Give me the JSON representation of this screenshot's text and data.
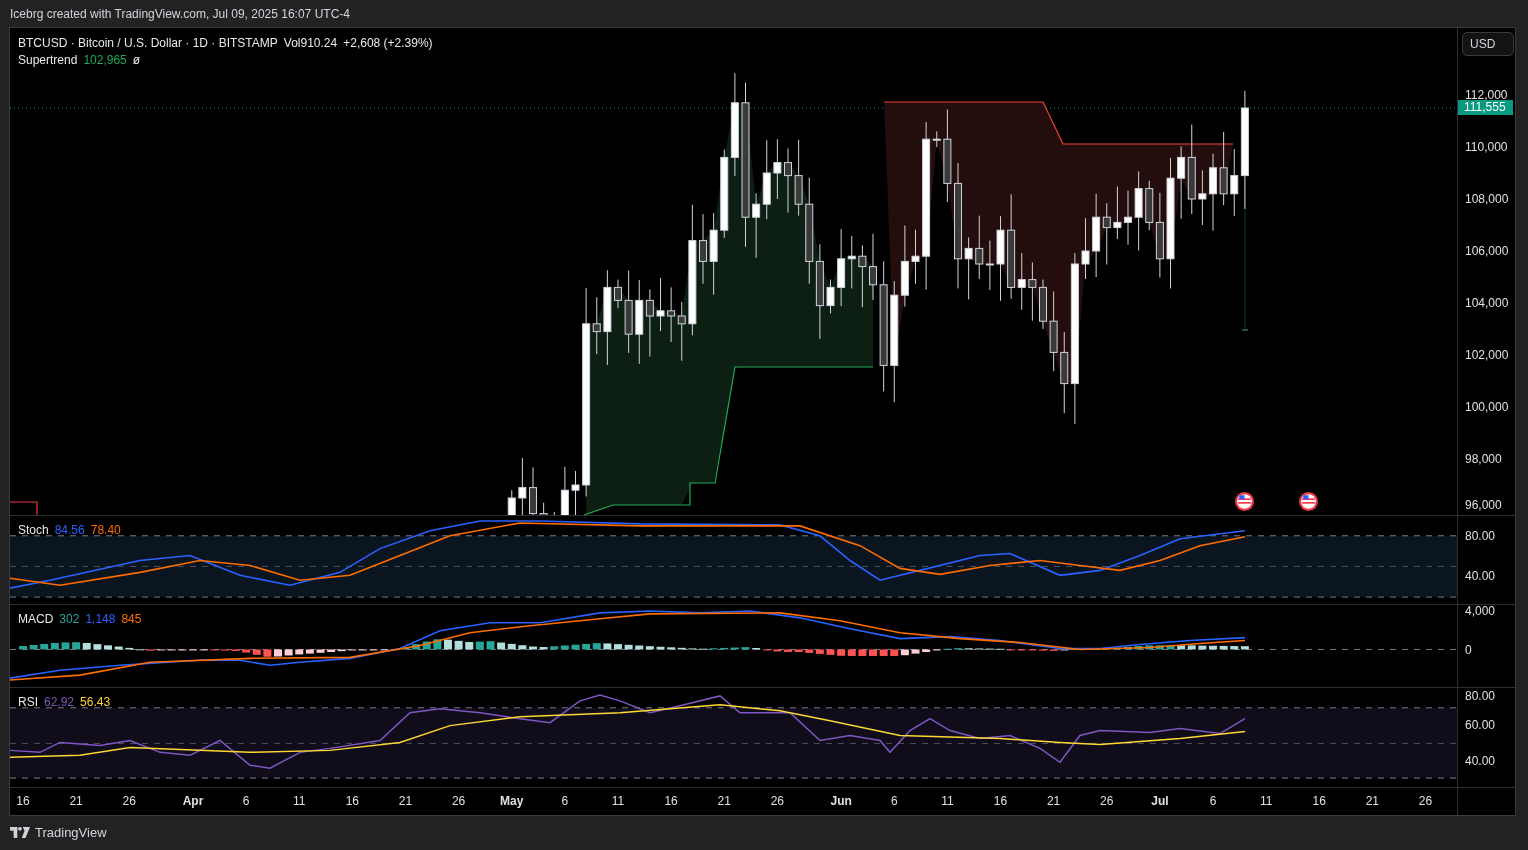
{
  "caption": "Icebrg created with TradingView.com, Jul 09, 2025 16:07 UTC-4",
  "price_panel": {
    "symbol": "BTCUSD · Bitcoin / U.S. Dollar · 1D · BITSTAMP",
    "volume": "Vol910.24",
    "change": "+2,608 (+2.39%)",
    "indicator": {
      "name": "Supertrend",
      "value": "102,965",
      "symbol": "ø"
    },
    "currency_button": "USD",
    "last_price": "111,555",
    "axis_labels": [
      "112,000",
      "110,000",
      "108,000",
      "106,000",
      "104,000",
      "102,000",
      "100,000",
      "98,000",
      "96,000"
    ]
  },
  "stoch": {
    "name": "Stoch",
    "values": [
      {
        "text": "84.56",
        "color": "#2962ff"
      },
      {
        "text": "78.40",
        "color": "#ff6d00"
      }
    ],
    "axis_labels": [
      "80.00",
      "40.00"
    ]
  },
  "macd": {
    "name": "MACD",
    "values": [
      {
        "text": "302",
        "color": "#26a69a"
      },
      {
        "text": "1,148",
        "color": "#2962ff"
      },
      {
        "text": "845",
        "color": "#ff6d00"
      }
    ],
    "axis_labels": [
      "4,000",
      "0"
    ]
  },
  "rsi": {
    "name": "RSI",
    "values": [
      {
        "text": "62.92",
        "color": "#7e57c2"
      },
      {
        "text": "56.43",
        "color": "#fdd835"
      }
    ],
    "axis_labels": [
      "80.00",
      "60.00",
      "40.00"
    ]
  },
  "time_axis": [
    {
      "label": "16",
      "kind": "day"
    },
    {
      "label": "21",
      "kind": "day"
    },
    {
      "label": "26",
      "kind": "day"
    },
    {
      "label": "Apr",
      "kind": "month"
    },
    {
      "label": "6",
      "kind": "day"
    },
    {
      "label": "11",
      "kind": "day"
    },
    {
      "label": "16",
      "kind": "day"
    },
    {
      "label": "21",
      "kind": "day"
    },
    {
      "label": "26",
      "kind": "day"
    },
    {
      "label": "May",
      "kind": "month"
    },
    {
      "label": "6",
      "kind": "day"
    },
    {
      "label": "11",
      "kind": "day"
    },
    {
      "label": "16",
      "kind": "day"
    },
    {
      "label": "21",
      "kind": "day"
    },
    {
      "label": "26",
      "kind": "day"
    },
    {
      "label": "Jun",
      "kind": "month"
    },
    {
      "label": "6",
      "kind": "day"
    },
    {
      "label": "11",
      "kind": "day"
    },
    {
      "label": "16",
      "kind": "day"
    },
    {
      "label": "21",
      "kind": "day"
    },
    {
      "label": "26",
      "kind": "day"
    },
    {
      "label": "Jul",
      "kind": "month"
    },
    {
      "label": "6",
      "kind": "day"
    },
    {
      "label": "11",
      "kind": "day"
    },
    {
      "label": "16",
      "kind": "day"
    },
    {
      "label": "21",
      "kind": "day"
    },
    {
      "label": "26",
      "kind": "day"
    }
  ],
  "footer": {
    "brand": "TradingView"
  }
}
